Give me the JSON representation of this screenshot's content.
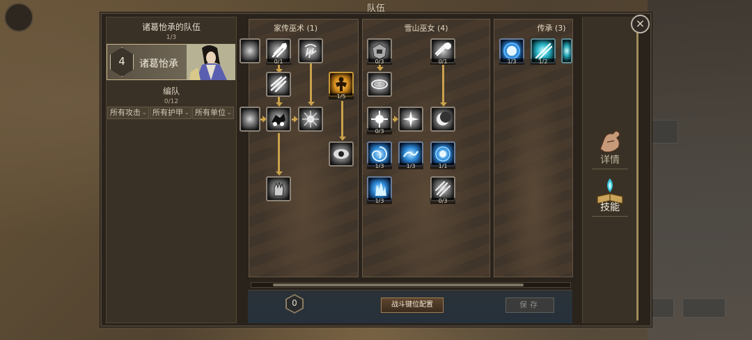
{
  "window": {
    "title": "队伍"
  },
  "left_panel": {
    "team_title": "诸葛怡承的队伍",
    "team_count": "1/3",
    "hero": {
      "level": "4",
      "name": "诸葛怡承"
    },
    "formation_title": "编队",
    "formation_count": "0/12",
    "filters": [
      "所有攻击",
      "所有护甲",
      "所有单位"
    ]
  },
  "skill_trees": [
    {
      "title": "家传巫术 (1)",
      "skills": [
        {
          "icon": "comet-icon",
          "count": "0/1"
        },
        {
          "icon": "lightning-storm-icon",
          "count": ""
        },
        {
          "icon": "claw-strike-icon",
          "count": ""
        },
        {
          "icon": "golden-warrior-icon",
          "count": "1/5"
        },
        {
          "icon": "partial-skill-icon",
          "count": ""
        },
        {
          "icon": "war-chariot-icon",
          "count": ""
        },
        {
          "icon": "spirit-burst-icon",
          "count": ""
        },
        {
          "icon": "all-seeing-eye-icon",
          "count": ""
        },
        {
          "icon": "grasping-hand-icon",
          "count": ""
        }
      ]
    },
    {
      "title": "雪山巫女 (4)",
      "skills": [
        {
          "icon": "stone-guardian-icon",
          "count": "0/3"
        },
        {
          "icon": "comet-icon",
          "count": "0/1"
        },
        {
          "icon": "whirlwind-ring-icon",
          "count": ""
        },
        {
          "icon": "radiant-eye-icon",
          "count": "0/3"
        },
        {
          "icon": "star-burst-icon",
          "count": ""
        },
        {
          "icon": "crescent-orb-icon",
          "count": ""
        },
        {
          "icon": "frost-vortex-icon",
          "count": "1/3"
        },
        {
          "icon": "frost-wave-icon",
          "count": "1/3"
        },
        {
          "icon": "frost-pulse-icon",
          "count": "1/1"
        },
        {
          "icon": "ice-crystal-icon",
          "count": "1/3"
        },
        {
          "icon": "ice-claw-icon",
          "count": "0/3"
        }
      ]
    },
    {
      "title": "传承 (3)",
      "skills": [
        {
          "icon": "arcane-orb-icon",
          "count": "1/3"
        },
        {
          "icon": "cyan-slash-icon",
          "count": "1/2"
        },
        {
          "icon": "cyan-slash-icon",
          "count": ""
        }
      ]
    }
  ],
  "bottom_bar": {
    "points": "0",
    "config_button": "战斗键位配置",
    "save_button": "保存"
  },
  "side_rail": {
    "tabs": [
      {
        "label": "详情",
        "icon": "flexed-arm-icon"
      },
      {
        "label": "技能",
        "icon": "spellbook-icon"
      }
    ]
  },
  "close_label": "×",
  "colors": {
    "link_gold": "#caa24c",
    "panel_bg": "#3a3126",
    "frost_blue": "#2e8bd9",
    "gold_skill": "#d18b1c"
  }
}
